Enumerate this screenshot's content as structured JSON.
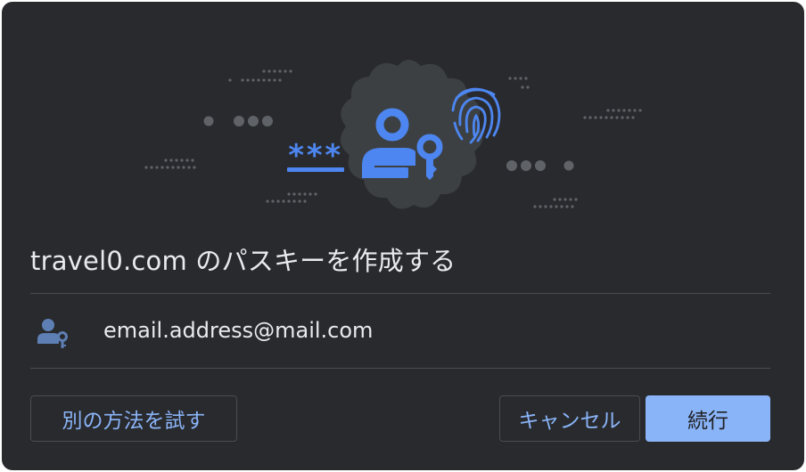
{
  "dialog": {
    "title": "travel0.com のパスキーを作成する",
    "account": {
      "icon": "person-key-icon",
      "email": "email.address@mail.com"
    },
    "buttons": {
      "other_method": "別の方法を試す",
      "cancel": "キャンセル",
      "continue": "続行"
    }
  },
  "illustration": {
    "password_mask": "***",
    "icons": [
      "passkey-person-key-icon",
      "fingerprint-icon",
      "password-mask-icon"
    ]
  },
  "colors": {
    "background": "#292a2d",
    "text": "#e8eaed",
    "accent": "#8ab4f8",
    "illustration_blue": "#4d86f0",
    "badge": "#3c4043",
    "divider": "#4a4c50"
  }
}
